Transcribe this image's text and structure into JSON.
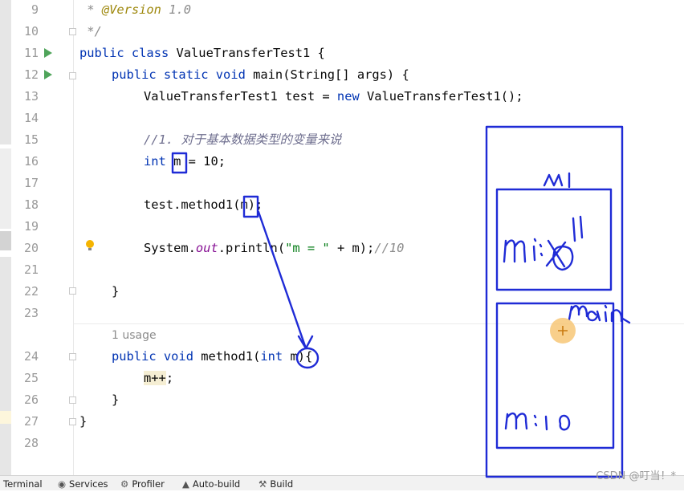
{
  "line_numbers": [
    "9",
    "10",
    "11",
    "12",
    "13",
    "14",
    "15",
    "16",
    "17",
    "18",
    "19",
    "20",
    "21",
    "22",
    "23",
    "24",
    "25",
    "26",
    "27",
    "28"
  ],
  "code": {
    "l9": {
      "prefix": " * ",
      "annotation": "@Version",
      "rest": " 1.0"
    },
    "l10": {
      "text": " */"
    },
    "l11": {
      "kw1": "public",
      "kw2": "class",
      "rest": " ValueTransferTest1 {"
    },
    "l12": {
      "kw1": "public",
      "kw2": "static",
      "kw3": "void",
      "rest": " main(String[] args) {"
    },
    "l13": {
      "a": "ValueTransferTest1 test = ",
      "kw": "new",
      "b": " ValueTransferTest1();"
    },
    "l15": {
      "comment": "//1. 对于基本数据类型的变量来说"
    },
    "l16": {
      "kw": "int",
      "sp": " ",
      "var": "m",
      "rest": " = 10;"
    },
    "l18": {
      "a": "test.method1(",
      "var": "m",
      "b": ");"
    },
    "l20": {
      "a": "System.",
      "field": "out",
      "b": ".println(",
      "str": "\"m = \"",
      "c": " + m);",
      "comment": "//10"
    },
    "l22": {
      "text": "}"
    },
    "usage": "1 usage",
    "l24": {
      "kw1": "public",
      "kw2": "void",
      "a": " method1(",
      "kw3": "int",
      "sp": " ",
      "var": "m",
      "b": "){"
    },
    "l25": {
      "var": "m++",
      "b": ";"
    },
    "l26": {
      "text": "}"
    },
    "l27": {
      "text": "}"
    }
  },
  "statusbar": {
    "terminal": "Terminal",
    "services": "Services",
    "profiler": "Profiler",
    "autobuild": "Auto-build",
    "build": "Build"
  },
  "watermark": "CSDN @叮当！*",
  "annotations": {
    "stack_label_top": "m1",
    "frame_top_text": "m:10 → 11",
    "stack_label_bottom": "main",
    "frame_bottom_text": "m:10",
    "ink_color": "#1f2bd6",
    "cursor_color": "#f5a623"
  },
  "colors": {
    "keyword": "#0033b3",
    "comment": "#8c8c8c",
    "string": "#067d17",
    "field": "#871094",
    "annotation": "#9e880d",
    "run_icon": "#4fa45a",
    "gutter_text": "#9a9a9a"
  },
  "icons": [
    "run-icon",
    "fold-icon",
    "intention-bulb-icon",
    "terminal-icon",
    "services-icon",
    "profiler-icon",
    "warning-icon",
    "build-icon"
  ]
}
